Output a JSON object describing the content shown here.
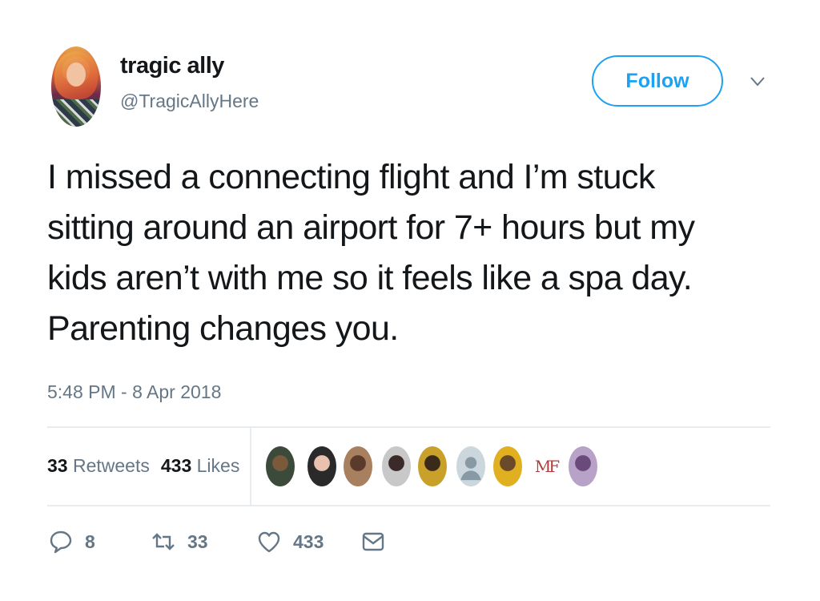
{
  "author": {
    "name": "tragic ally",
    "handle": "@TragicAllyHere"
  },
  "follow_label": "Follow",
  "tweet": {
    "lines": [
      "I missed a connecting flight and I’m stuck",
      "sitting around an airport for 7+ hours but my",
      "kids aren’t with me so it feels like a spa day.",
      "Parenting changes you."
    ],
    "timestamp": "5:48 PM - 8 Apr 2018"
  },
  "stats": {
    "retweets_count": "33",
    "retweets_label": "Retweets",
    "likes_count": "433",
    "likes_label": "Likes"
  },
  "likers": [
    {
      "icon": "liker-avatar-1",
      "colors": [
        "#3b4a3a",
        "#7a5a3a"
      ]
    },
    {
      "icon": "liker-avatar-2",
      "colors": [
        "#2a2a2a",
        "#e9c1b0"
      ]
    },
    {
      "icon": "liker-avatar-3",
      "colors": [
        "#a88060",
        "#5a3a2a"
      ]
    },
    {
      "icon": "liker-avatar-4",
      "colors": [
        "#c8c8c8",
        "#3a2a2a"
      ]
    },
    {
      "icon": "liker-avatar-5",
      "colors": [
        "#c9a12a",
        "#3a2a1a"
      ]
    },
    {
      "icon": "liker-avatar-default",
      "colors": [
        "#ccd6dd",
        "#8899a6"
      ]
    },
    {
      "icon": "liker-avatar-7",
      "colors": [
        "#e0b020",
        "#6a4a2a"
      ]
    },
    {
      "icon": "liker-avatar-mf",
      "text": "MF"
    },
    {
      "icon": "liker-avatar-9",
      "colors": [
        "#b8a2c8",
        "#6a4a7a"
      ]
    }
  ],
  "actions": {
    "reply_count": "8",
    "retweet_count": "33",
    "like_count": "433"
  },
  "colors": {
    "accent": "#1da1f2",
    "secondary_text": "#657786",
    "divider": "#e6ecf0"
  }
}
